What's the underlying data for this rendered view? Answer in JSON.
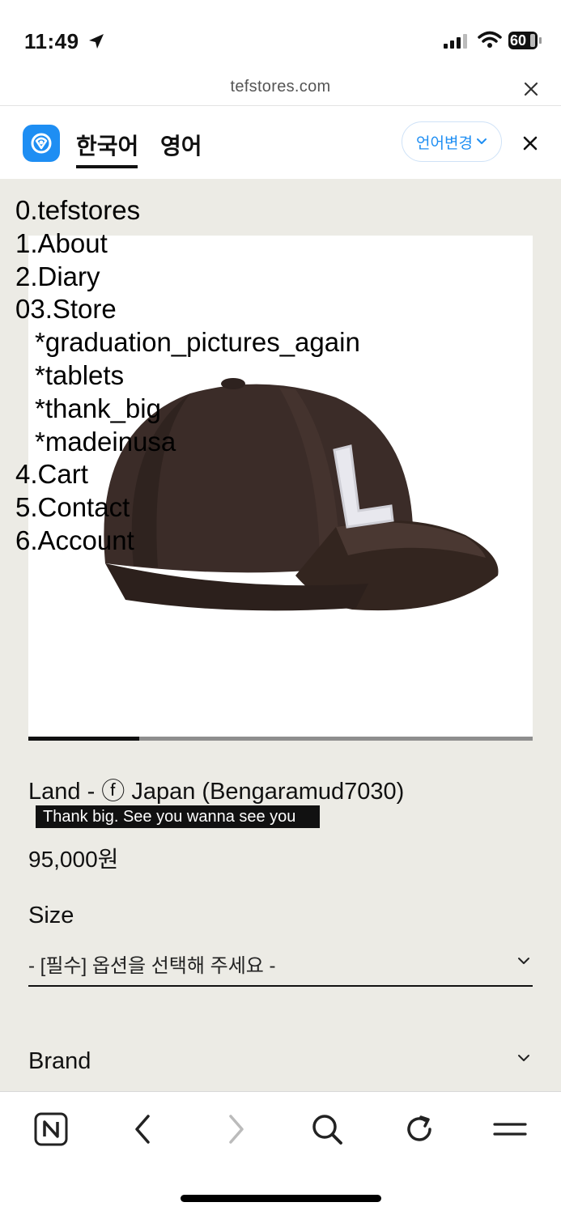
{
  "status_bar": {
    "time": "11:49",
    "battery_level": "60",
    "icons": [
      "location-arrow-icon",
      "cellular-signal-icon",
      "wifi-icon",
      "battery-icon"
    ]
  },
  "browser": {
    "url": "tefstores.com",
    "close_icon": "close-icon"
  },
  "translate_bar": {
    "logo_icon": "papago-translate-icon",
    "tabs": [
      "한국어",
      "영어"
    ],
    "active_tab": "한국어",
    "language_change_label": "언어변경",
    "close_icon": "close-icon"
  },
  "site_menu": {
    "items": [
      "0.tefstores",
      "1.About",
      "2.Diary",
      "03.Store",
      "*graduation_pictures_again",
      "*tablets",
      "*thank_big",
      "*madeinusa",
      "4.Cart",
      "5.Contact",
      "6.Account"
    ]
  },
  "product": {
    "image_icon": "baseball-cap-image",
    "image_progress": 0.22,
    "title": "Land - ⓕ Japan (Bengaramud7030)",
    "tagline": "Thank big. See you wanna see you",
    "price": "95,000원"
  },
  "options": {
    "size_label": "Size",
    "size_placeholder": "- [필수] 옵션을 선택해 주세요 -",
    "brand_label": "Brand"
  },
  "toolbar": {
    "icons": [
      "naver-home-icon",
      "back-arrow-icon",
      "forward-arrow-icon",
      "search-icon",
      "refresh-icon",
      "menu-icon"
    ]
  },
  "colors": {
    "page_background": "#ecebe5",
    "accent_blue": "#1e8ef3",
    "cap_color": "#3a2b27"
  }
}
